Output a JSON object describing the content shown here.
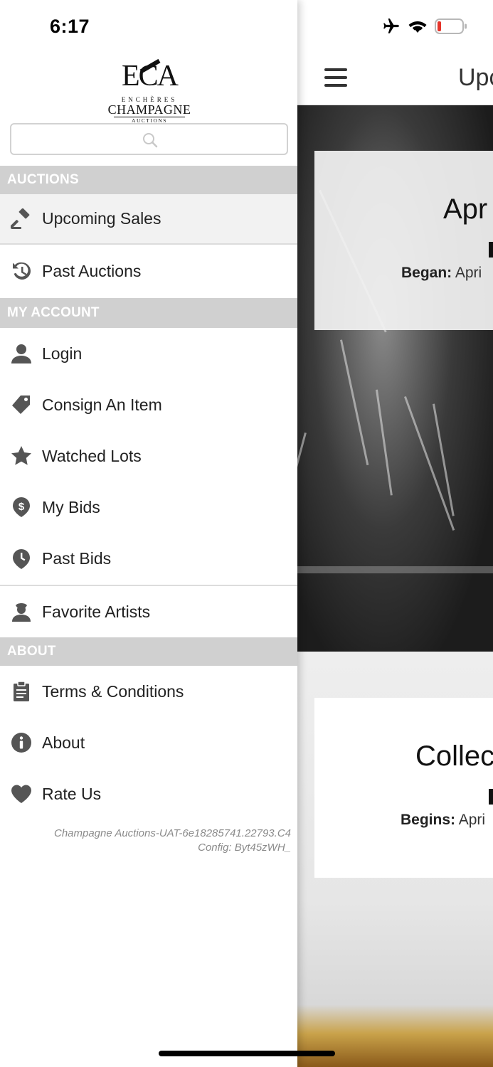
{
  "status_bar": {
    "time": "6:17"
  },
  "main": {
    "header_title": "Upc",
    "cards": [
      {
        "title": "Apr",
        "date_label": "Began:",
        "date_value": "Apri"
      },
      {
        "title": "Collec",
        "date_label": "Begins:",
        "date_value": "Apri"
      }
    ]
  },
  "drawer": {
    "logo": {
      "mark": "ECA",
      "line1": "ENCHÈRES",
      "line2": "CHAMPAGNE",
      "line3": "AUCTIONS"
    },
    "search": {
      "placeholder": ""
    },
    "sections": {
      "auctions": "AUCTIONS",
      "my_account": "MY ACCOUNT",
      "about": "ABOUT"
    },
    "items": {
      "upcoming_sales": "Upcoming Sales",
      "past_auctions": "Past Auctions",
      "login": "Login",
      "consign": "Consign An Item",
      "watched_lots": "Watched Lots",
      "my_bids": "My Bids",
      "past_bids": "Past Bids",
      "favorite_artists": "Favorite Artists",
      "terms": "Terms & Conditions",
      "about": "About",
      "rate_us": "Rate Us"
    },
    "footer": {
      "build": "Champagne Auctions-UAT-6e18285741.22793.C4",
      "config": "Config: Byt45zWH_"
    }
  },
  "colors": {
    "section_bg": "#d0d0d0",
    "icon": "#555555",
    "active_bg": "#f2f2f2"
  }
}
